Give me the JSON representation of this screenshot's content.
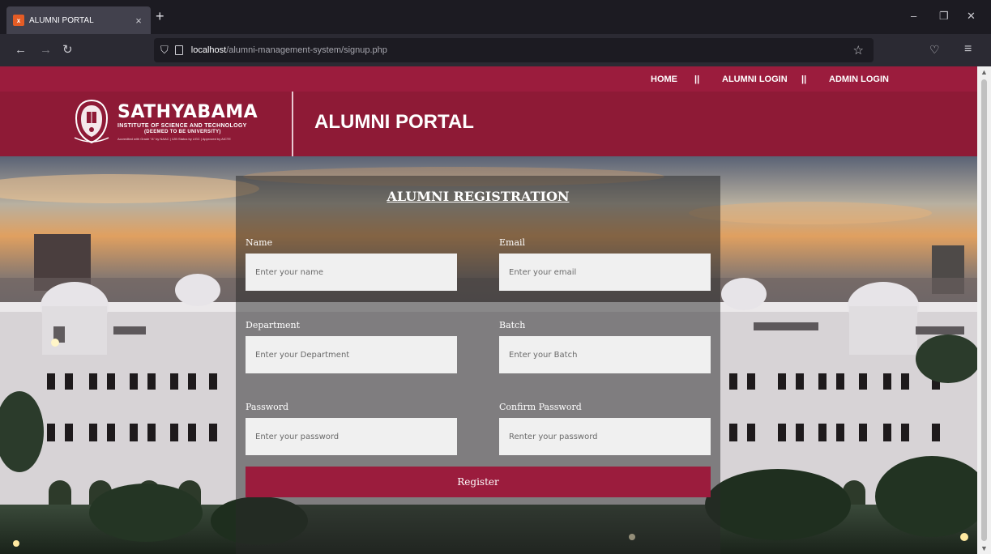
{
  "browser": {
    "tab_title": "ALUMNI PORTAL",
    "tab_close": "×",
    "new_tab": "+",
    "url_host": "localhost",
    "url_path": "/alumni-management-system/signup.php",
    "icons": [
      "back-icon",
      "forward-icon",
      "reload-icon",
      "shield-icon",
      "page-icon",
      "star-icon",
      "pocket-icon",
      "menu-icon"
    ]
  },
  "topnav": {
    "home": "HOME",
    "sep1": "||",
    "alumni_login": "ALUMNI LOGIN",
    "sep2": "||",
    "admin_login": "ADMIN LOGIN"
  },
  "header": {
    "logo_name": "SATHYABAMA",
    "logo_sub1": "INSTITUTE OF SCIENCE AND TECHNOLOGY",
    "logo_sub2": "(DEEMED TO BE UNIVERSITY)",
    "logo_sub3": "Accredited with Grade \"A\" by NAAC | 12B Status by UGC | Approved by AICTE",
    "portal_title": "ALUMNI PORTAL"
  },
  "form": {
    "title": "ALUMNI REGISTRATION",
    "name_label": "Name",
    "name_placeholder": "Enter your name",
    "email_label": "Email",
    "email_placeholder": "Enter your email",
    "department_label": "Department",
    "department_placeholder": "Enter your Department",
    "batch_label": "Batch",
    "batch_placeholder": "Enter your Batch",
    "password_label": "Password",
    "password_placeholder": "Enter your password",
    "confirm_label": "Confirm Password",
    "confirm_placeholder": "Renter your password",
    "register_label": "Register"
  },
  "colors": {
    "brand_primary": "#9b1c3d",
    "brand_dark": "#8e1a36",
    "panel_overlay": "rgba(40,40,40,0.5)"
  }
}
